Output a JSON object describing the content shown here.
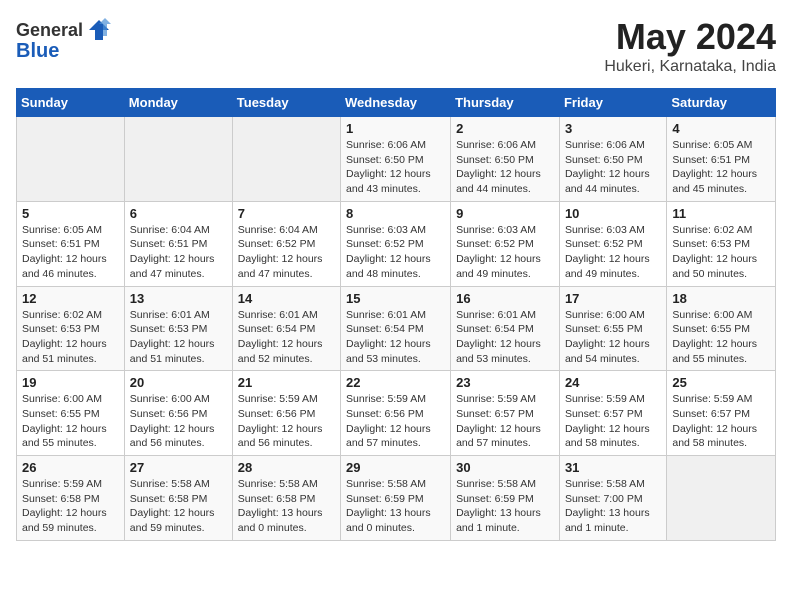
{
  "header": {
    "logo_general": "General",
    "logo_blue": "Blue",
    "title": "May 2024",
    "subtitle": "Hukeri, Karnataka, India"
  },
  "calendar": {
    "weekdays": [
      "Sunday",
      "Monday",
      "Tuesday",
      "Wednesday",
      "Thursday",
      "Friday",
      "Saturday"
    ],
    "weeks": [
      [
        {
          "day": "",
          "info": ""
        },
        {
          "day": "",
          "info": ""
        },
        {
          "day": "",
          "info": ""
        },
        {
          "day": "1",
          "info": "Sunrise: 6:06 AM\nSunset: 6:50 PM\nDaylight: 12 hours\nand 43 minutes."
        },
        {
          "day": "2",
          "info": "Sunrise: 6:06 AM\nSunset: 6:50 PM\nDaylight: 12 hours\nand 44 minutes."
        },
        {
          "day": "3",
          "info": "Sunrise: 6:06 AM\nSunset: 6:50 PM\nDaylight: 12 hours\nand 44 minutes."
        },
        {
          "day": "4",
          "info": "Sunrise: 6:05 AM\nSunset: 6:51 PM\nDaylight: 12 hours\nand 45 minutes."
        }
      ],
      [
        {
          "day": "5",
          "info": "Sunrise: 6:05 AM\nSunset: 6:51 PM\nDaylight: 12 hours\nand 46 minutes."
        },
        {
          "day": "6",
          "info": "Sunrise: 6:04 AM\nSunset: 6:51 PM\nDaylight: 12 hours\nand 47 minutes."
        },
        {
          "day": "7",
          "info": "Sunrise: 6:04 AM\nSunset: 6:52 PM\nDaylight: 12 hours\nand 47 minutes."
        },
        {
          "day": "8",
          "info": "Sunrise: 6:03 AM\nSunset: 6:52 PM\nDaylight: 12 hours\nand 48 minutes."
        },
        {
          "day": "9",
          "info": "Sunrise: 6:03 AM\nSunset: 6:52 PM\nDaylight: 12 hours\nand 49 minutes."
        },
        {
          "day": "10",
          "info": "Sunrise: 6:03 AM\nSunset: 6:52 PM\nDaylight: 12 hours\nand 49 minutes."
        },
        {
          "day": "11",
          "info": "Sunrise: 6:02 AM\nSunset: 6:53 PM\nDaylight: 12 hours\nand 50 minutes."
        }
      ],
      [
        {
          "day": "12",
          "info": "Sunrise: 6:02 AM\nSunset: 6:53 PM\nDaylight: 12 hours\nand 51 minutes."
        },
        {
          "day": "13",
          "info": "Sunrise: 6:01 AM\nSunset: 6:53 PM\nDaylight: 12 hours\nand 51 minutes."
        },
        {
          "day": "14",
          "info": "Sunrise: 6:01 AM\nSunset: 6:54 PM\nDaylight: 12 hours\nand 52 minutes."
        },
        {
          "day": "15",
          "info": "Sunrise: 6:01 AM\nSunset: 6:54 PM\nDaylight: 12 hours\nand 53 minutes."
        },
        {
          "day": "16",
          "info": "Sunrise: 6:01 AM\nSunset: 6:54 PM\nDaylight: 12 hours\nand 53 minutes."
        },
        {
          "day": "17",
          "info": "Sunrise: 6:00 AM\nSunset: 6:55 PM\nDaylight: 12 hours\nand 54 minutes."
        },
        {
          "day": "18",
          "info": "Sunrise: 6:00 AM\nSunset: 6:55 PM\nDaylight: 12 hours\nand 55 minutes."
        }
      ],
      [
        {
          "day": "19",
          "info": "Sunrise: 6:00 AM\nSunset: 6:55 PM\nDaylight: 12 hours\nand 55 minutes."
        },
        {
          "day": "20",
          "info": "Sunrise: 6:00 AM\nSunset: 6:56 PM\nDaylight: 12 hours\nand 56 minutes."
        },
        {
          "day": "21",
          "info": "Sunrise: 5:59 AM\nSunset: 6:56 PM\nDaylight: 12 hours\nand 56 minutes."
        },
        {
          "day": "22",
          "info": "Sunrise: 5:59 AM\nSunset: 6:56 PM\nDaylight: 12 hours\nand 57 minutes."
        },
        {
          "day": "23",
          "info": "Sunrise: 5:59 AM\nSunset: 6:57 PM\nDaylight: 12 hours\nand 57 minutes."
        },
        {
          "day": "24",
          "info": "Sunrise: 5:59 AM\nSunset: 6:57 PM\nDaylight: 12 hours\nand 58 minutes."
        },
        {
          "day": "25",
          "info": "Sunrise: 5:59 AM\nSunset: 6:57 PM\nDaylight: 12 hours\nand 58 minutes."
        }
      ],
      [
        {
          "day": "26",
          "info": "Sunrise: 5:59 AM\nSunset: 6:58 PM\nDaylight: 12 hours\nand 59 minutes."
        },
        {
          "day": "27",
          "info": "Sunrise: 5:58 AM\nSunset: 6:58 PM\nDaylight: 12 hours\nand 59 minutes."
        },
        {
          "day": "28",
          "info": "Sunrise: 5:58 AM\nSunset: 6:58 PM\nDaylight: 13 hours\nand 0 minutes."
        },
        {
          "day": "29",
          "info": "Sunrise: 5:58 AM\nSunset: 6:59 PM\nDaylight: 13 hours\nand 0 minutes."
        },
        {
          "day": "30",
          "info": "Sunrise: 5:58 AM\nSunset: 6:59 PM\nDaylight: 13 hours\nand 1 minute."
        },
        {
          "day": "31",
          "info": "Sunrise: 5:58 AM\nSunset: 7:00 PM\nDaylight: 13 hours\nand 1 minute."
        },
        {
          "day": "",
          "info": ""
        }
      ]
    ]
  }
}
